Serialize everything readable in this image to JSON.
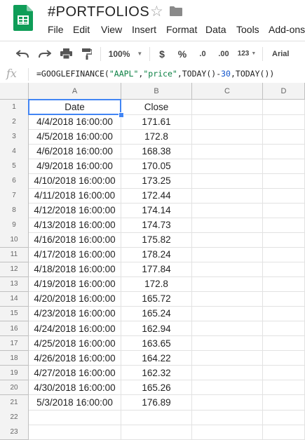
{
  "document": {
    "title": "#PORTFOLIOS"
  },
  "icons": {
    "logo": "sheets-logo-icon",
    "star": "star-icon",
    "folder": "folder-icon"
  },
  "colors": {
    "accent": "#0f9d58",
    "selection": "#4285f4"
  },
  "menu": [
    "File",
    "Edit",
    "View",
    "Insert",
    "Format",
    "Data",
    "Tools",
    "Add-ons"
  ],
  "toolbar": {
    "zoom": "100%",
    "currency": "$",
    "percent": "%",
    "decrease_decimals": ".0",
    "increase_decimals": ".00",
    "more_formats": "123",
    "font": "Arial"
  },
  "formula_bar": {
    "fx": "fx",
    "parts": [
      "=GOOGLEFINANCE(",
      "\"AAPL\"",
      ",",
      "\"price\"",
      ",TODAY()-",
      "30",
      ",TODAY())"
    ]
  },
  "sheet": {
    "columns": [
      "A",
      "B",
      "C",
      "D"
    ],
    "row_numbers": [
      "1",
      "2",
      "3",
      "4",
      "5",
      "6",
      "7",
      "8",
      "9",
      "10",
      "11",
      "12",
      "13",
      "14",
      "15",
      "16",
      "17",
      "18",
      "19",
      "20",
      "21",
      "22",
      "23"
    ],
    "headers": [
      "Date",
      "Close"
    ],
    "rows": [
      [
        "4/4/2018 16:00:00",
        "171.61"
      ],
      [
        "4/5/2018 16:00:00",
        "172.8"
      ],
      [
        "4/6/2018 16:00:00",
        "168.38"
      ],
      [
        "4/9/2018 16:00:00",
        "170.05"
      ],
      [
        "4/10/2018 16:00:00",
        "173.25"
      ],
      [
        "4/11/2018 16:00:00",
        "172.44"
      ],
      [
        "4/12/2018 16:00:00",
        "174.14"
      ],
      [
        "4/13/2018 16:00:00",
        "174.73"
      ],
      [
        "4/16/2018 16:00:00",
        "175.82"
      ],
      [
        "4/17/2018 16:00:00",
        "178.24"
      ],
      [
        "4/18/2018 16:00:00",
        "177.84"
      ],
      [
        "4/19/2018 16:00:00",
        "172.8"
      ],
      [
        "4/20/2018 16:00:00",
        "165.72"
      ],
      [
        "4/23/2018 16:00:00",
        "165.24"
      ],
      [
        "4/24/2018 16:00:00",
        "162.94"
      ],
      [
        "4/25/2018 16:00:00",
        "163.65"
      ],
      [
        "4/26/2018 16:00:00",
        "164.22"
      ],
      [
        "4/27/2018 16:00:00",
        "162.32"
      ],
      [
        "4/30/2018 16:00:00",
        "165.26"
      ],
      [
        "5/3/2018 16:00:00",
        "176.89"
      ]
    ]
  }
}
